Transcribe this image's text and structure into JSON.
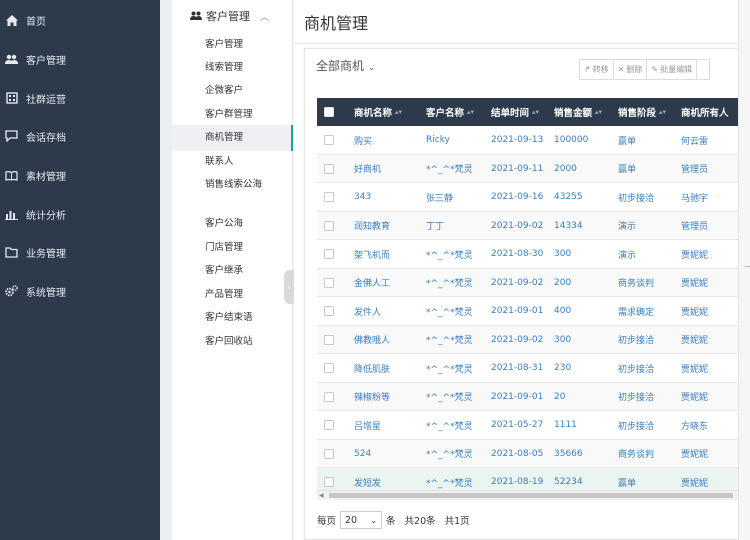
{
  "nav": [
    {
      "label": "首页",
      "icon": "home-icon"
    },
    {
      "label": "客户管理",
      "icon": "users-icon"
    },
    {
      "label": "社群运营",
      "icon": "building-icon"
    },
    {
      "label": "会话存档",
      "icon": "chat-icon"
    },
    {
      "label": "素材管理",
      "icon": "book-icon"
    },
    {
      "label": "统计分析",
      "icon": "bar-chart-icon"
    },
    {
      "label": "业务管理",
      "icon": "folder-icon"
    },
    {
      "label": "系统管理",
      "icon": "gears-icon"
    }
  ],
  "submenu": {
    "title": "客户管理",
    "items": [
      "客户管理",
      "线索管理",
      "企微客户",
      "客户群管理",
      "商机管理",
      "联系人",
      "销售线索公海",
      "客户公海",
      "门店管理",
      "客户继承",
      "产品管理",
      "客户结束语",
      "客户回收站"
    ],
    "active_index": 4
  },
  "page": {
    "title": "商机管理"
  },
  "filter": {
    "label": "全部商机"
  },
  "toolbar": {
    "transfer": "转移",
    "delete": "删除",
    "batch_edit": "批量编辑"
  },
  "table": {
    "columns": [
      "商机名称",
      "客户名称",
      "结单时间",
      "销售金额",
      "销售阶段",
      "商机所有人"
    ],
    "rows": [
      {
        "name": "购买",
        "customer": "Ricky",
        "date": "2021-09-13",
        "amount": "100000",
        "stage": "赢单",
        "owner": "何云雷"
      },
      {
        "name": "好商机",
        "customer": "*^_^*梵灵",
        "date": "2021-09-11",
        "amount": "2000",
        "stage": "赢单",
        "owner": "管理员"
      },
      {
        "name": "343",
        "customer": "张三静",
        "date": "2021-09-16",
        "amount": "43255",
        "stage": "初步接洽",
        "owner": "马驰宇"
      },
      {
        "name": "润知教育",
        "customer": "丁丁",
        "date": "2021-09-02",
        "amount": "14334",
        "stage": "演示",
        "owner": "管理员"
      },
      {
        "name": "架飞机而",
        "customer": "*^_^*梵灵",
        "date": "2021-08-30",
        "amount": "300",
        "stage": "演示",
        "owner": "贾妮妮"
      },
      {
        "name": "金佛人工",
        "customer": "*^_^*梵灵",
        "date": "2021-09-02",
        "amount": "200",
        "stage": "商务谈判",
        "owner": "贾妮妮"
      },
      {
        "name": "发件人",
        "customer": "*^_^*梵灵",
        "date": "2021-09-01",
        "amount": "400",
        "stage": "需求确定",
        "owner": "贾妮妮"
      },
      {
        "name": "佛教哦人",
        "customer": "*^_^*梵灵",
        "date": "2021-09-02",
        "amount": "300",
        "stage": "初步接洽",
        "owner": "贾妮妮"
      },
      {
        "name": "降低肌肤",
        "customer": "*^_^*梵灵",
        "date": "2021-08-31",
        "amount": "230",
        "stage": "初步接洽",
        "owner": "贾妮妮"
      },
      {
        "name": "辣椒粉等",
        "customer": "*^_^*梵灵",
        "date": "2021-09-01",
        "amount": "20",
        "stage": "初步接洽",
        "owner": "贾妮妮"
      },
      {
        "name": "吕增星",
        "customer": "*^_^*梵灵",
        "date": "2021-05-27",
        "amount": "1111",
        "stage": "初步接洽",
        "owner": "方晓东"
      },
      {
        "name": "524",
        "customer": "*^_^*梵灵",
        "date": "2021-08-05",
        "amount": "35666",
        "stage": "商务谈判",
        "owner": "贾妮妮"
      },
      {
        "name": "发短发",
        "customer": "*^_^*梵灵",
        "date": "2021-08-19",
        "amount": "52234",
        "stage": "赢单",
        "owner": "贾妮妮"
      }
    ]
  },
  "pagination": {
    "per_page_label": "每页",
    "page_size": "20",
    "unit_label": "条",
    "total_text": "共20条",
    "pages_text": "共1页"
  },
  "colors": {
    "sidebar_bg": "#2d3a4b",
    "header_bg": "#2d3a4b",
    "link": "#3a7fc1",
    "active_accent": "#1aa39b"
  }
}
